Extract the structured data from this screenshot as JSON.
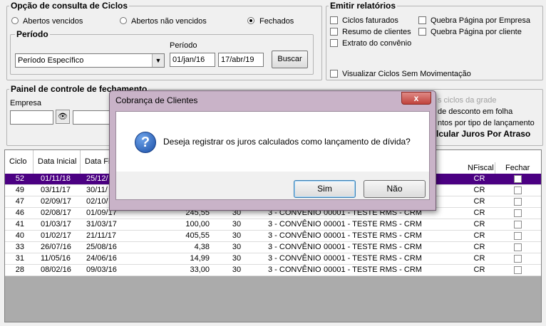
{
  "opcao": {
    "title": "Opção de consulta de Ciclos",
    "radios": [
      {
        "label": "Abertos vencidos",
        "checked": false
      },
      {
        "label": "Abertos não vencidos",
        "checked": false
      },
      {
        "label": "Fechados",
        "checked": true
      }
    ]
  },
  "periodo": {
    "title": "Período",
    "select_value": "Período Específico",
    "range_label": "Período",
    "start": "01/jan/16",
    "end": "17/abr/19",
    "search_label": "Buscar"
  },
  "relatorios": {
    "title": "Emitir relatórios",
    "left": [
      "Ciclos faturados",
      "Resumo de clientes",
      "Extrato do convênio"
    ],
    "right": [
      "Quebra Página por Empresa",
      "Quebra Página por cliente"
    ],
    "bottom": "Visualizar Ciclos Sem Movimentação"
  },
  "painel": {
    "title": "Painel de controle de fechamento",
    "empresa_label": "Empresa",
    "right_partial": [
      "s ciclos da grade",
      "de desconto em folha",
      "ntos por tipo de lançamento",
      "lcular Juros Por Atraso"
    ]
  },
  "grid": {
    "headers": [
      "Ciclo",
      "Data Inicial",
      "Data Fi",
      "NFiscal",
      "Fechar"
    ],
    "rows": [
      {
        "ciclo": "52",
        "inicial": "01/11/18",
        "final": "25/12/",
        "valor": "",
        "dias": "",
        "conv": "",
        "cliente": "",
        "nf": "CR",
        "sel": true
      },
      {
        "ciclo": "49",
        "inicial": "03/11/17",
        "final": "30/11/",
        "valor": "",
        "dias": "",
        "conv": "",
        "cliente": "",
        "nf": "CR",
        "sel": false
      },
      {
        "ciclo": "47",
        "inicial": "02/09/17",
        "final": "02/10/",
        "valor": "",
        "dias": "",
        "conv": "",
        "cliente": "",
        "nf": "CR",
        "sel": false
      },
      {
        "ciclo": "46",
        "inicial": "02/08/17",
        "final": "01/09/17",
        "valor": "245,55",
        "dias": "30",
        "conv": "3 - CONVÊNIO",
        "cliente": "00001 - TESTE RMS - CRM",
        "nf": "CR",
        "sel": false
      },
      {
        "ciclo": "41",
        "inicial": "01/03/17",
        "final": "31/03/17",
        "valor": "100,00",
        "dias": "30",
        "conv": "3 - CONVÊNIO",
        "cliente": "00001 - TESTE RMS - CRM",
        "nf": "CR",
        "sel": false
      },
      {
        "ciclo": "40",
        "inicial": "01/02/17",
        "final": "21/11/17",
        "valor": "405,55",
        "dias": "30",
        "conv": "3 - CONVÊNIO",
        "cliente": "00001 - TESTE RMS - CRM",
        "nf": "CR",
        "sel": false
      },
      {
        "ciclo": "33",
        "inicial": "26/07/16",
        "final": "25/08/16",
        "valor": "4,38",
        "dias": "30",
        "conv": "3 - CONVÊNIO",
        "cliente": "00001 - TESTE RMS - CRM",
        "nf": "CR",
        "sel": false
      },
      {
        "ciclo": "31",
        "inicial": "11/05/16",
        "final": "24/06/16",
        "valor": "14,99",
        "dias": "30",
        "conv": "3 - CONVÊNIO",
        "cliente": "00001 - TESTE RMS - CRM",
        "nf": "CR",
        "sel": false
      },
      {
        "ciclo": "28",
        "inicial": "08/02/16",
        "final": "09/03/16",
        "valor": "33,00",
        "dias": "30",
        "conv": "3 - CONVÊNIO",
        "cliente": "00001 - TESTE RMS - CRM",
        "nf": "CR",
        "sel": false
      }
    ]
  },
  "dialog": {
    "title": "Cobrança de Clientes",
    "message": "Deseja registrar os juros calculados como lançamento de dívida?",
    "yes_label": "Sim",
    "no_label": "Não",
    "close_glyph": "x",
    "question_glyph": "?"
  },
  "colors": {
    "selection": "#4b0082",
    "window_bg": "#f0f0f0",
    "dialog_frame": "#c9b3c8"
  }
}
